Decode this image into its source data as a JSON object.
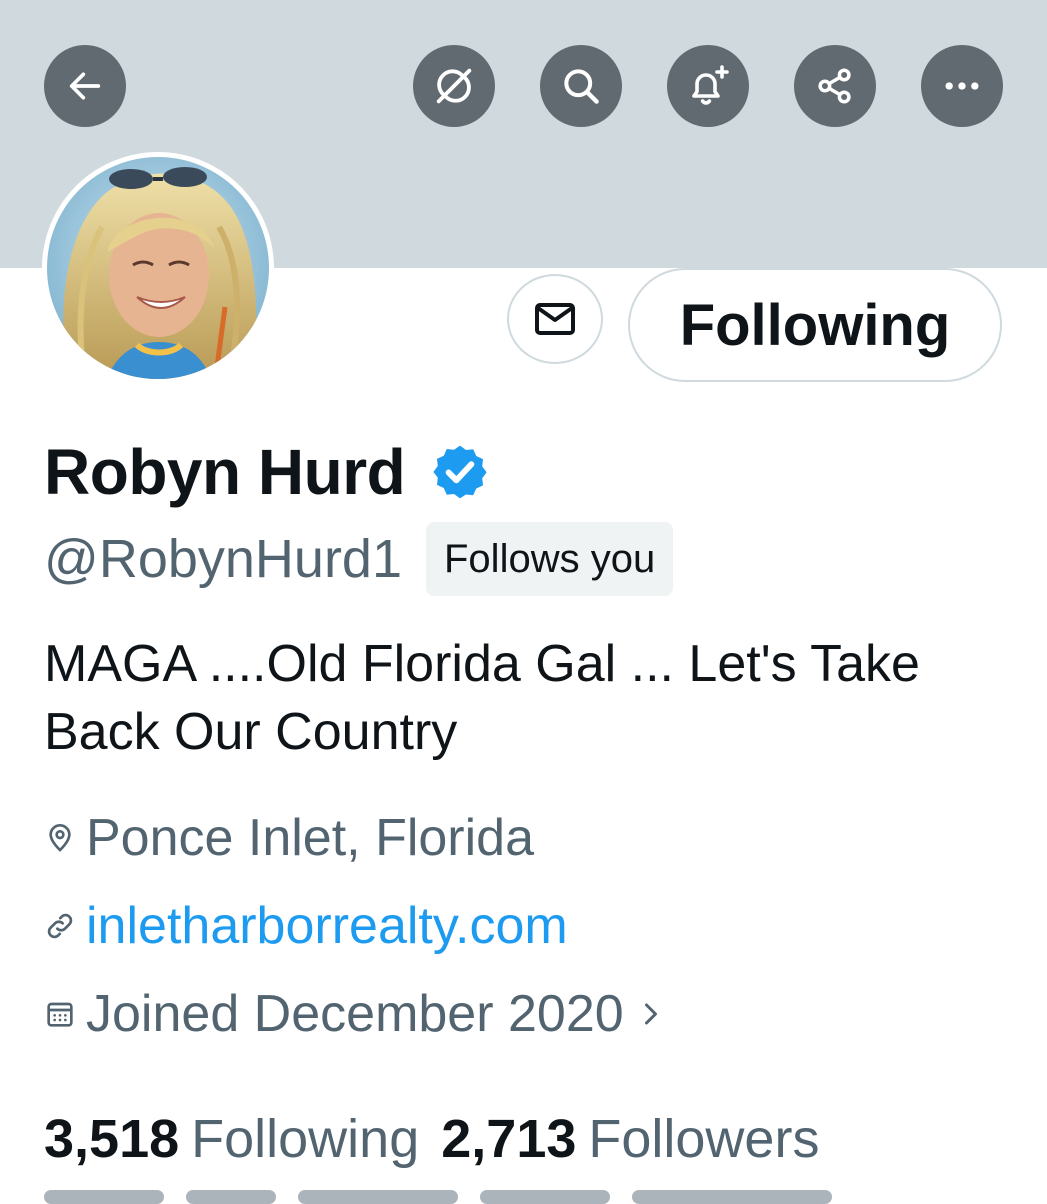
{
  "header": {
    "back_icon": "arrow-left-icon",
    "actions": [
      {
        "icon": "grok-icon"
      },
      {
        "icon": "search-icon"
      },
      {
        "icon": "bell-plus-icon"
      },
      {
        "icon": "share-icon"
      },
      {
        "icon": "more-icon"
      }
    ]
  },
  "profile": {
    "name": "Robyn Hurd",
    "handle": "@RobynHurd1",
    "follows_you": "Follows you",
    "follow_button": "Following",
    "bio": "MAGA ....Old Florida Gal ... Let's Take Back Our Country",
    "location": "Ponce Inlet, Florida",
    "website": "inletharborrealty.com",
    "joined": "Joined December 2020",
    "following_count": "3,518",
    "following_label": "Following",
    "followers_count": "2,713",
    "followers_label": "Followers"
  },
  "colors": {
    "banner": "#cfd9de",
    "icon_button": "#616a70",
    "link": "#1d9bf0",
    "verified": "#1d9bf0",
    "secondary_text": "#536471"
  }
}
